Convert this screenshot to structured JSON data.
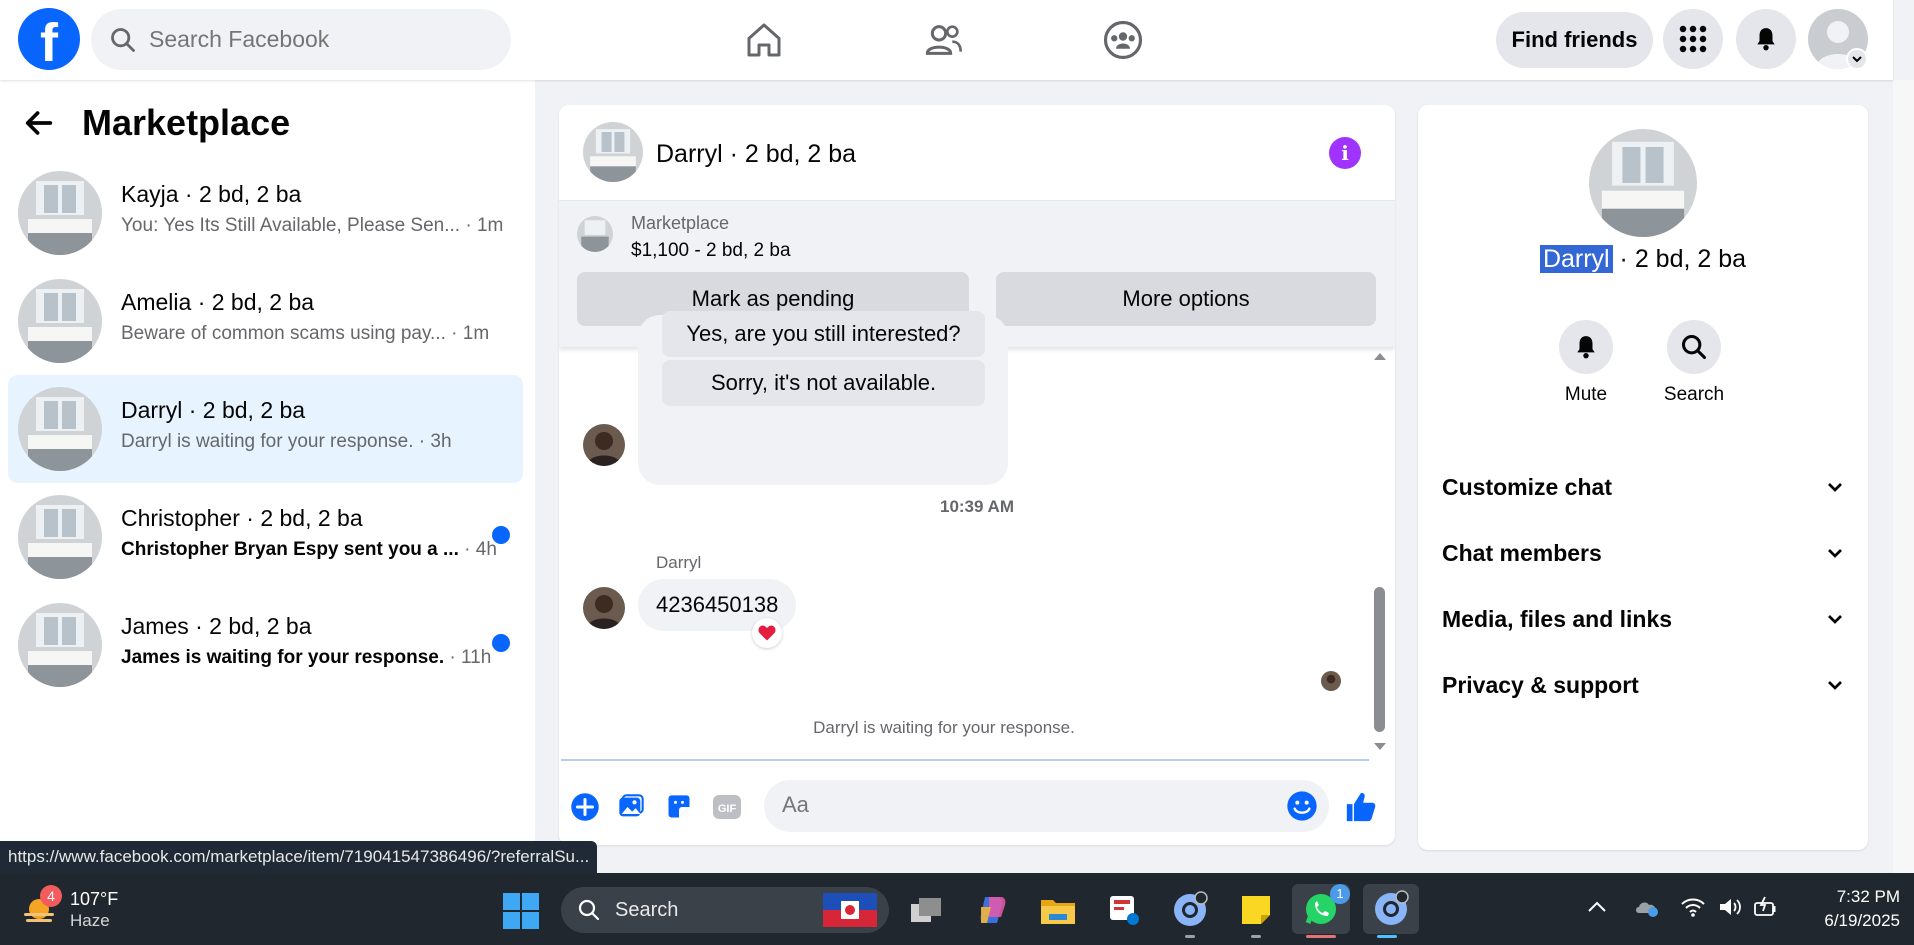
{
  "header": {
    "logo": "f",
    "search_placeholder": "Search Facebook",
    "find_friends": "Find friends"
  },
  "sidebar": {
    "title": "Marketplace",
    "conversations": [
      {
        "name": "Kayja · 2 bd, 2 ba",
        "preview": "You: Yes Its Still Available, Please Sen...",
        "time": " · 1m",
        "unread": false,
        "active": false
      },
      {
        "name": "Amelia · 2 bd, 2 ba",
        "preview": "Beware of common scams using pay...",
        "time": " · 1m",
        "unread": false,
        "active": false
      },
      {
        "name": "Darryl · 2 bd, 2 ba",
        "preview": "Darryl is waiting for your response.",
        "time": " · 3h",
        "unread": false,
        "active": true
      },
      {
        "name": "Christopher · 2 bd, 2 ba",
        "preview": "Christopher Bryan Espy sent you a ...",
        "time": " · 4h",
        "unread": true,
        "active": false
      },
      {
        "name": "James · 2 bd, 2 ba",
        "preview": "James is waiting for your response.",
        "time": " · 11h",
        "unread": true,
        "active": false
      }
    ]
  },
  "chat": {
    "title": "Darryl · 2 bd, 2 ba",
    "marketplace_label": "Marketplace",
    "listing": "$1,100 - 2 bd, 2 ba",
    "mark_pending": "Mark as pending",
    "more_options": "More options",
    "quick_reply_1": "Yes, are you still interested?",
    "quick_reply_2": "Sorry, it's not available.",
    "timestamp": "10:39 AM",
    "sender": "Darryl",
    "message": "4236450138",
    "waiting": "Darryl is waiting for your response.",
    "input_placeholder": "Aa"
  },
  "details": {
    "name_highlight": "Darryl",
    "name_rest": " · 2 bd, 2 ba",
    "mute": "Mute",
    "search": "Search",
    "sections": [
      "Customize chat",
      "Chat members",
      "Media, files and links",
      "Privacy & support"
    ]
  },
  "status_url": "https://www.facebook.com/marketplace/item/719041547386496/?referralSu...",
  "taskbar": {
    "weather_badge": "4",
    "temp": "107°F",
    "condition": "Haze",
    "search": "Search",
    "whatsapp_badge": "1",
    "time": "7:32 PM",
    "date": "6/19/2025"
  },
  "colors": {
    "brand": "#0866ff",
    "active_row": "#e7f3ff",
    "info": "#a033ff",
    "reaction": "#e41e3f"
  }
}
